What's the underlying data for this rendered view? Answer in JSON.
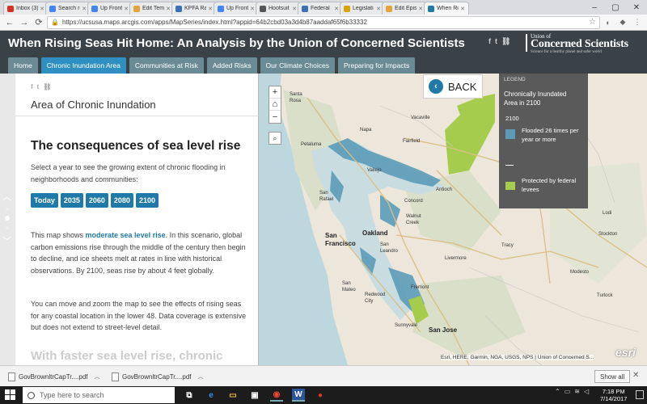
{
  "browser": {
    "tabs": [
      {
        "label": "Inbox (3)",
        "color": "#d93025"
      },
      {
        "label": "Search re",
        "color": "#4285f4"
      },
      {
        "label": "Up Front",
        "color": "#4285f4"
      },
      {
        "label": "Edit Tem",
        "color": "#e6a23c"
      },
      {
        "label": "KPFA Ra",
        "color": "#3b6fb6"
      },
      {
        "label": "Up Front",
        "color": "#4285f4"
      },
      {
        "label": "Hootsuit",
        "color": "#555555"
      },
      {
        "label": "Federal",
        "color": "#3b6fb6"
      },
      {
        "label": "Legislati",
        "color": "#d9a300"
      },
      {
        "label": "Edit Epis",
        "color": "#e6a23c"
      },
      {
        "label": "When Ri",
        "color": "#1f7aa8"
      }
    ],
    "url": "https://ucsusa.maps.arcgis.com/apps/MapSeries/index.html?appid=64b2cbd03a3d4b87aaddaf65f6b33332",
    "window_controls": [
      "–",
      "▢",
      "✕"
    ]
  },
  "header": {
    "title": "When Rising Seas Hit Home: An Analysis by the Union of Concerned Scientists",
    "share_icons": [
      "f",
      "t",
      "⛓"
    ],
    "logo": {
      "line1": "Union of",
      "line2": "Concerned Scientists",
      "line3": "Science for a healthy planet and safer world"
    },
    "tabs": [
      {
        "label": "Home",
        "active": false
      },
      {
        "label": "Chronic Inundation Area",
        "active": true
      },
      {
        "label": "Communities at Risk",
        "active": false
      },
      {
        "label": "Added Risks",
        "active": false
      },
      {
        "label": "Our Climate Choices",
        "active": false
      },
      {
        "label": "Preparing for Impacts",
        "active": false
      }
    ]
  },
  "panel": {
    "icons": [
      "f",
      "t",
      "⛓"
    ],
    "title": "Area of Chronic Inundation",
    "heading": "The consequences of sea level rise",
    "intro": "Select a year to see the growing extent of chronic flooding in neighborhoods and communities:",
    "years": [
      "Today",
      "2035",
      "2060",
      "2080",
      "2100"
    ],
    "para2_pre": "This map shows ",
    "para2_link": "moderate sea level rise",
    "para2_post": ". In this scenario, global carbon emissions rise through the middle of the century then begin to decline, and ice sheets melt at rates in line with historical observations. By 2100, seas rise by about 4 feet globally.",
    "para3": "You can move and zoom the map to see the effects of rising seas for any coastal location in the lower 48. Data coverage is extensive but does not extend to street-level detail.",
    "fading_heading": "With faster sea level rise, chronic"
  },
  "map": {
    "zoom": [
      "+",
      "⌂",
      "−"
    ],
    "search_icon": "⌕",
    "back_label": "BACK",
    "legend": {
      "header": "LEGEND",
      "title": "Chronically Inundated Area in 2100",
      "year": "2100",
      "item1": "Flooded 26 times per year or more",
      "item1_color": "#5b9bb8",
      "item2": "Protected by federal levees",
      "item2_color": "#a6cc4d"
    },
    "labels": {
      "santa_rosa": "Santa Rosa",
      "napa": "Napa",
      "vacaville": "Vacaville",
      "fairfield": "Fairfield",
      "petaluma": "Petaluma",
      "vallejo": "Vallejo",
      "antioch": "Antioch",
      "san_rafael": "San Rafael",
      "concord": "Concord",
      "walnut_creek": "Walnut Creek",
      "stockton": "Stockton",
      "lodi": "Lodi",
      "san_francisco": "San Francisco",
      "oakland": "Oakland",
      "san_leandro": "San Leandro",
      "livermore": "Livermore",
      "tracy": "Tracy",
      "san_mateo": "San Mateo",
      "redwood_city": "Redwood City",
      "fremont": "Fremont",
      "sunnyvale": "Sunnyvale",
      "san_jose": "San Jose",
      "modesto": "Modesto",
      "turlock": "Turlock"
    },
    "attribution": "Esri, HERE, Garmin, NGA, USGS, NPS | Union of Concerned S...",
    "esri_logo": "esri"
  },
  "downloads": {
    "items": [
      "GovBrownltrCapTr....pdf",
      "GovBrownltrCapTr....pdf"
    ],
    "show_all": "Show all",
    "close": "✕"
  },
  "taskbar": {
    "search_placeholder": "Type here to search",
    "time": "7:18 PM",
    "date": "7/14/2017"
  }
}
